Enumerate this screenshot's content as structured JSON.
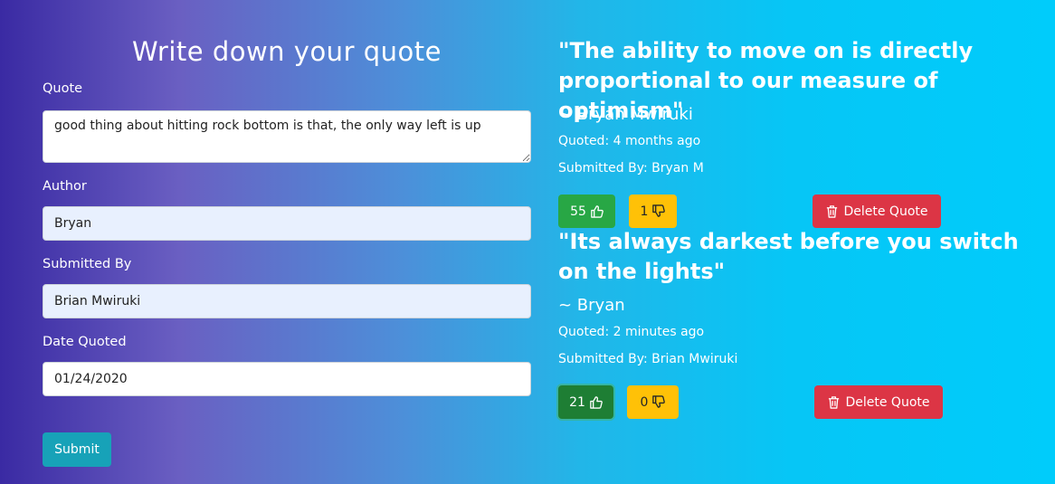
{
  "form": {
    "title": "Write down your quote",
    "quote_label": "Quote",
    "quote_value": "good thing about hitting rock bottom is that, the only way left is up",
    "author_label": "Author",
    "author_value": "Bryan",
    "submitted_by_label": "Submitted By",
    "submitted_by_value": "Brian Mwiruki",
    "date_label": "Date Quoted",
    "date_value": "01/24/2020",
    "submit_label": "Submit"
  },
  "quotes": [
    {
      "text": "\"The ability to move on is directly proportional to our measure of optimism\"",
      "author": "~ Bryan Mwiruki",
      "quoted": "Quoted: 4 months ago",
      "submitted_by": "Submitted By: Bryan M",
      "upvotes": "55",
      "downvotes": "1",
      "delete_label": "Delete Quote"
    },
    {
      "text": "\"Its always darkest before you switch on the lights\"",
      "author": "~ Bryan",
      "quoted": "Quoted: 2 minutes ago",
      "submitted_by": "Submitted By: Brian Mwiruki",
      "upvotes": "21",
      "downvotes": "0",
      "delete_label": "Delete Quote"
    }
  ],
  "icons": {
    "upvote": "thumbs-up-icon",
    "downvote": "thumbs-down-icon",
    "delete": "trash-icon"
  },
  "colors": {
    "upvote": "#28a745",
    "downvote": "#ffc107",
    "delete": "#dc3545",
    "submit": "#17a2b8"
  }
}
